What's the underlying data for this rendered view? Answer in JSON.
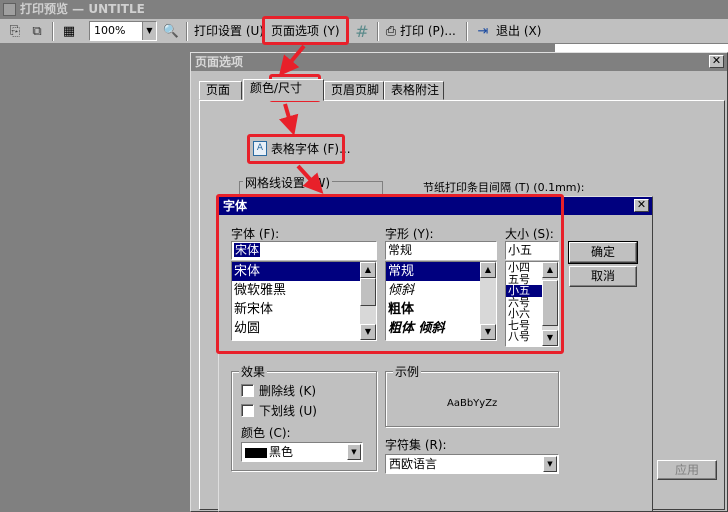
{
  "app": {
    "title": "打印预览 — UNTITLE"
  },
  "toolbar": {
    "zoom": "100%",
    "print_setup": "打印设置 (U)",
    "page_options": "页面选项 (Y)",
    "print": "打印 (P)...",
    "exit": "退出 (X)"
  },
  "page_dialog": {
    "title": "页面选项",
    "tabs": [
      "页面",
      "颜色/尺寸",
      "页眉页脚",
      "表格附注"
    ],
    "font_button": "表格字体 (F)...",
    "grid_group": "网格线设置 (W)",
    "spacing_label": "节纸打印条目间隔 (T) (0.1mm):",
    "apply": "应用"
  },
  "font_dialog": {
    "title": "字体",
    "font_label": "字体 (F):",
    "font_value": "宋体",
    "fonts": [
      "宋体",
      "微软雅黑",
      "新宋体",
      "幼圆"
    ],
    "style_label": "字形 (Y):",
    "style_value": "常规",
    "styles": [
      "常规",
      "倾斜",
      "粗体",
      "粗体 倾斜"
    ],
    "size_label": "大小 (S):",
    "size_value": "小五",
    "sizes": [
      "小四",
      "五号",
      "小五",
      "六号",
      "小六",
      "七号",
      "八号"
    ],
    "ok": "确定",
    "cancel": "取消",
    "effects_label": "效果",
    "strikeout": "删除线 (K)",
    "underline": "下划线 (U)",
    "color_label": "颜色 (C):",
    "color_value": "黑色",
    "sample_label": "示例",
    "sample_text": "AaBbYyZz",
    "charset_label": "字符集 (R):",
    "charset_value": "西欧语言"
  },
  "colors": {
    "highlight": "#e8202a",
    "active_title": "#00007f",
    "face": "#c0c0c0"
  },
  "icons": [
    "page-icon",
    "copy-icon",
    "grid-icon",
    "zoom-icon",
    "crop-icon",
    "printer-icon",
    "exit-icon",
    "font-icon"
  ]
}
